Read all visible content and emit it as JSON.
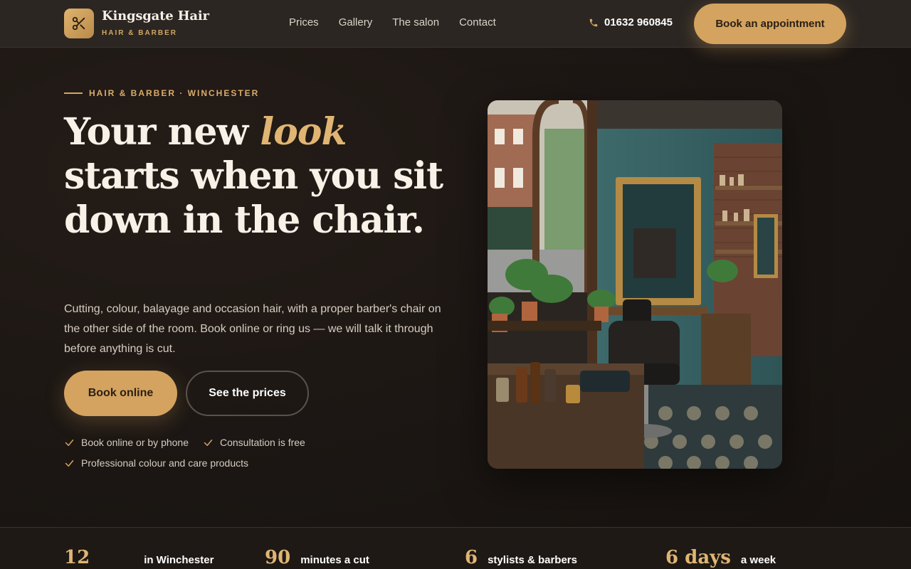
{
  "brand": {
    "name": "Kingsgate Hair",
    "tagline": "HAIR & BARBER"
  },
  "nav": {
    "items": [
      "Prices",
      "Gallery",
      "The salon",
      "Contact"
    ]
  },
  "header": {
    "phone": "01632 960845",
    "book_label": "Book an appointment"
  },
  "hero": {
    "eyebrow": "HAIR & BARBER · WINCHESTER",
    "headline_1": "Your new ",
    "headline_accent": "look",
    "headline_2": "starts when you sit down in the chair.",
    "lede": "Cutting, colour, balayage and occasion hair, with a proper barber's chair on the other side of the room. Book online or ring us — we will talk it through before anything is cut.",
    "primary_cta": "Book online",
    "secondary_cta": "See the prices",
    "checks": [
      "Book online or by phone",
      "Consultation is free",
      "Professional colour and care products"
    ]
  },
  "stats": [
    {
      "num": "12",
      "label": "in Winchester"
    },
    {
      "num": "90",
      "label": "minutes a cut"
    },
    {
      "num": "6",
      "label": "stylists & barbers"
    },
    {
      "num": "6 days",
      "label": "a week"
    }
  ],
  "colors": {
    "accent": "#d4a35f",
    "background": "#1b1613",
    "header": "#2b2622"
  },
  "icons": {
    "logo": "scissors-icon",
    "phone": "phone-icon",
    "check": "check-icon"
  }
}
